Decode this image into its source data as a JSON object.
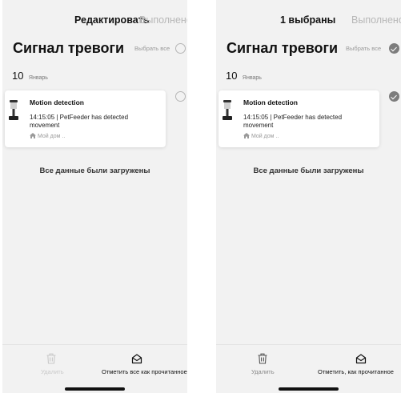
{
  "left_screen": {
    "header": {
      "edit_label": "Редактировать",
      "done_label": "Выполнено"
    },
    "title": "Сигнал тревоги",
    "select_all_label": "Выбрать все",
    "select_all_checked": false,
    "date": {
      "day": "10",
      "month": "Январь"
    },
    "alarm": {
      "title": "Motion detection",
      "message": "14:15:05 | PetFeeder has detected movement",
      "home": "Мой дом ..",
      "checked": false
    },
    "loaded_message": "Все данные были загружены",
    "bottom": {
      "delete_label": "Удалить",
      "mark_read_label": "Отметить все как прочитанное"
    }
  },
  "right_screen": {
    "header": {
      "selected_label": "1 выбраны",
      "done_label": "Выполнено"
    },
    "title": "Сигнал тревоги",
    "select_all_label": "Выбрать все",
    "select_all_checked": true,
    "date": {
      "day": "10",
      "month": "Январь"
    },
    "alarm": {
      "title": "Motion detection",
      "message": "14:15:05 | PetFeeder has detected movement",
      "home": "Мой дом ..",
      "checked": true
    },
    "loaded_message": "Все данные были загружены",
    "bottom": {
      "delete_label": "Удалить",
      "mark_read_label": "Отметить, как прочитанное"
    }
  },
  "colors": {
    "background": "#f2f2f2",
    "card": "#ffffff",
    "check": "#7d7d7d",
    "muted": "#b7b7b7"
  },
  "icons": [
    "device-icon",
    "home-icon",
    "trash-icon",
    "envelope-open-icon",
    "checkbox-circle-icon"
  ]
}
